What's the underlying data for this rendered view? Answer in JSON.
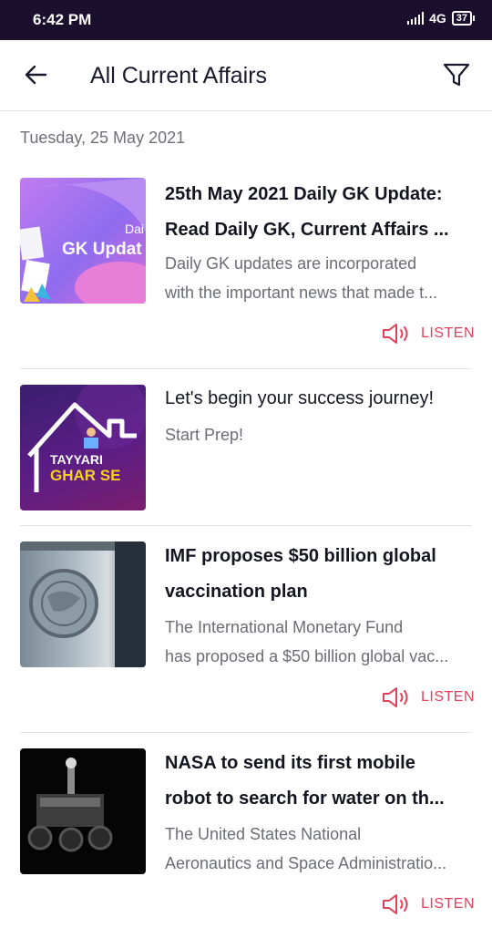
{
  "status_bar": {
    "time": "6:42 PM",
    "network": "4G",
    "battery": "37"
  },
  "header": {
    "title": "All Current Affairs"
  },
  "date": "Tuesday, 25 May 2021",
  "cards": [
    {
      "title_line1": "25th May 2021 Daily GK Update:",
      "title_line2": "Read Daily GK, Current Affairs ...",
      "desc_line1": "Daily GK updates are incorporated",
      "desc_line2": "with the important news that made t...",
      "thumb_text_small": "Dai",
      "thumb_text_big": "GK Updat",
      "listen_label": "LISTEN"
    },
    {
      "title_line1": "Let's begin your success journey!",
      "desc_line1": "Start Prep!",
      "thumb_text_line1": "TAYYARI",
      "thumb_text_line2": "GHAR SE"
    },
    {
      "title_line1": "IMF proposes $50 billion global",
      "title_line2": "vaccination plan",
      "desc_line1": "The International Monetary Fund",
      "desc_line2": "has proposed a $50 billion global vac...",
      "listen_label": "LISTEN"
    },
    {
      "title_line1": "NASA to send its first mobile",
      "title_line2": "robot to search for water on th...",
      "desc_line1": "The United States National",
      "desc_line2": "Aeronautics and Space Administratio...",
      "listen_label": "LISTEN"
    }
  ],
  "colors": {
    "status_bar_bg": "#1b0f2e",
    "accent": "#e0405a",
    "title_text": "#151522",
    "desc_text": "#6c6c76"
  }
}
